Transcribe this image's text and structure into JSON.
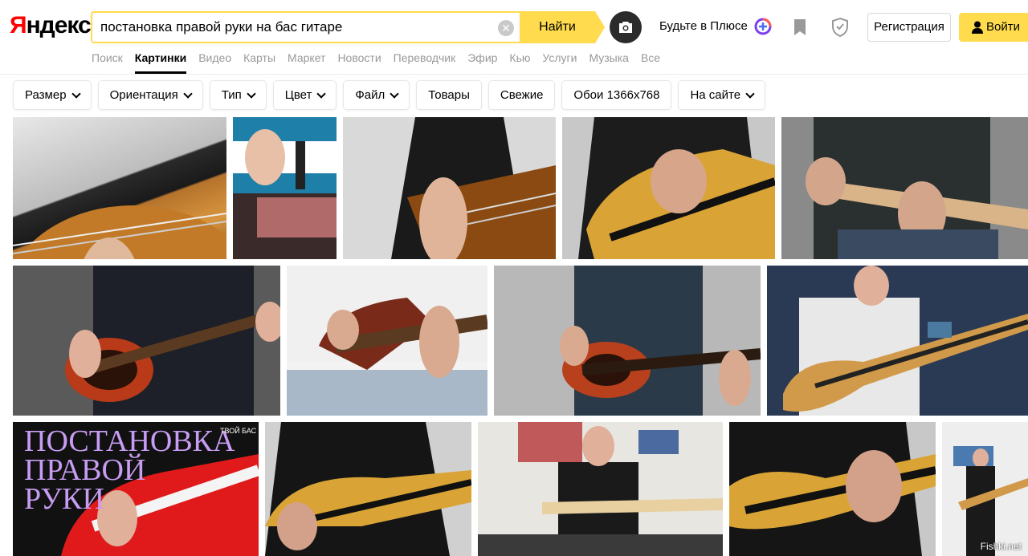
{
  "header": {
    "logo_first": "Я",
    "logo_rest": "ндекс",
    "search_value": "постановка правой руки на бас гитаре",
    "search_button": "Найти",
    "plus_label": "Будьте в Плюсе",
    "register_label": "Регистрация",
    "login_label": "Войти"
  },
  "nav": {
    "items": [
      "Поиск",
      "Картинки",
      "Видео",
      "Карты",
      "Маркет",
      "Новости",
      "Переводчик",
      "Эфир",
      "Кью",
      "Услуги",
      "Музыка",
      "Все"
    ],
    "active": "Картинки"
  },
  "filters": [
    {
      "label": "Размер",
      "dropdown": true
    },
    {
      "label": "Ориентация",
      "dropdown": true
    },
    {
      "label": "Тип",
      "dropdown": true
    },
    {
      "label": "Цвет",
      "dropdown": true
    },
    {
      "label": "Файл",
      "dropdown": true
    },
    {
      "label": "Товары",
      "dropdown": false
    },
    {
      "label": "Свежие",
      "dropdown": false
    },
    {
      "label": "Обои 1366x768",
      "dropdown": false
    },
    {
      "label": "На сайте",
      "dropdown": true
    }
  ],
  "thumbnails": {
    "row3_first_caption_lines": [
      "ПОСТАНОВКА",
      "ПРАВОЙ",
      "РУКИ"
    ],
    "row3_first_tag": "ТВОЙ БАС"
  },
  "watermark": "Fishki.net",
  "colors": {
    "accent_yellow": "#ffdb4d",
    "logo_red": "#ff0000"
  }
}
